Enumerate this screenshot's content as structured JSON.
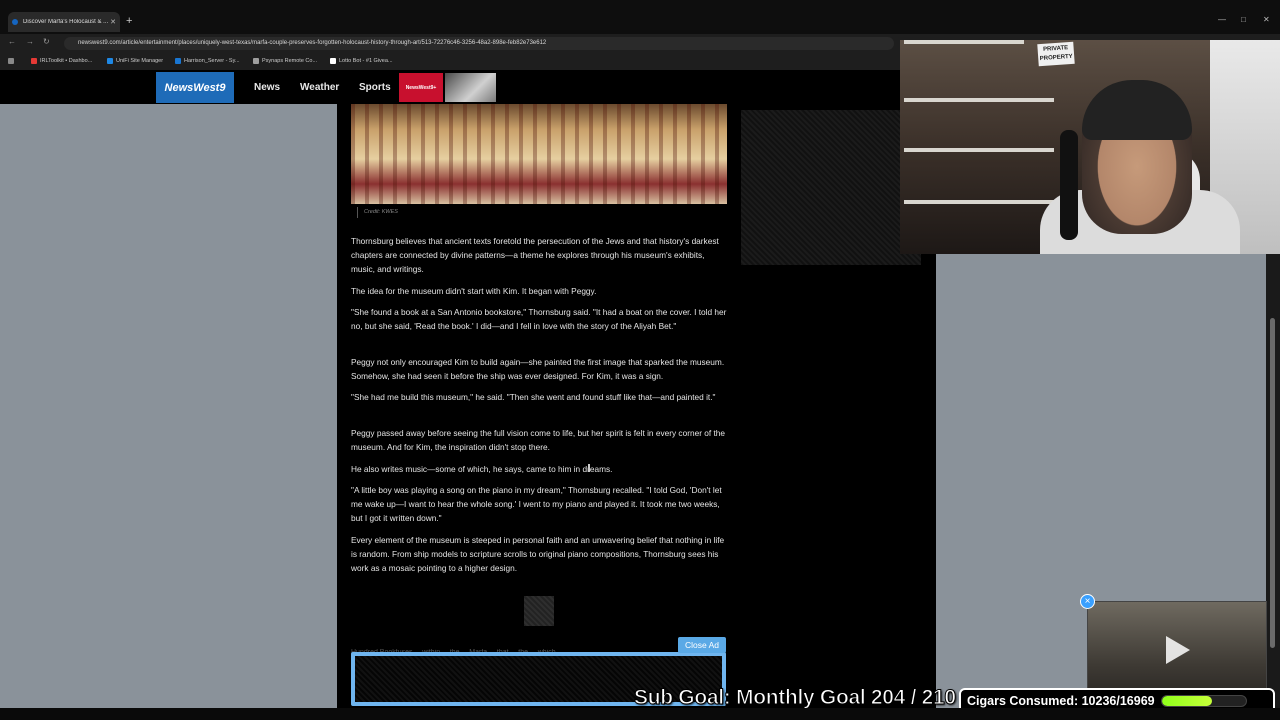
{
  "browser": {
    "tab_title": "Discover Marfa's Holocaust & ...",
    "url": "newswest9.com/article/entertainment/places/uniquely-west-texas/marfa-couple-preserves-forgotten-holocaust-history-through-art/513-72276c46-3256-48a2-898e-feb82e73e612",
    "bookmarks": [
      {
        "label": "IRLToolkit • Dashbo...",
        "color": "#e53935"
      },
      {
        "label": "UniFi Site Manager",
        "color": "#1e88e5"
      },
      {
        "label": "Harrison_Server - Sy...",
        "color": "#1976d2"
      },
      {
        "label": "Psynaps Remote Co...",
        "color": "#9e9e9e"
      },
      {
        "label": "Lotto Bot - #1 Givea...",
        "color": "#ffffff"
      }
    ]
  },
  "site": {
    "logo": "NewsWest9",
    "nav": [
      "News",
      "Weather",
      "Sports"
    ],
    "plus_label": "NewsWest9+"
  },
  "article": {
    "credit": "Credit: KWES",
    "paragraphs": [
      "Thornsburg believes that ancient texts foretold the persecution of the Jews and that history's darkest chapters are connected by divine patterns—a theme he explores through his museum's exhibits, music, and writings.",
      "The idea for the museum didn't start with Kim. It began with Peggy.",
      "\"She found a book at a San Antonio bookstore,\" Thornsburg said. \"It had a boat on the cover. I told her no, but she said, 'Read the book.' I did—and I fell in love with the story of the Aliyah Bet.\"",
      "Peggy not only encouraged Kim to build again—she painted the first image that sparked the museum. Somehow, she had seen it before the ship was ever designed. For Kim, it was a sign.",
      "\"She had me build this museum,\" he said. \"Then she went and found stuff like that—and painted it.\"",
      "Peggy passed away before seeing the full vision come to life, but her spirit is felt in every corner of the museum. And for Kim, the inspiration didn't stop there.",
      "He also writes music—some of which, he says, came to him in dreams.",
      "\"A little boy was playing a song on the piano in my dream,\" Thornsburg recalled. \"I told God, 'Don't let me wake up—I want to hear the whole song.' I went to my piano and played it. It took me two weeks, but I got it written down.\"",
      "Every element of the museum is steeped in personal faith and an unwavering belief that nothing in life is random. From ship models to scripture scrolls to original piano compositions, Thornsburg sees his work as a mosaic pointing to a higher design."
    ],
    "hidden_line": "Hundred Bookfuses ... within ... the ... Marfa ... that ... the ... which ..."
  },
  "ad": {
    "close_label": "Close Ad"
  },
  "webcam": {
    "sign_text": "PRIVATE PROPERTY"
  },
  "overlay": {
    "sub_goal": "Sub Goal: Monthly Goal  204 / 210",
    "cigars_label": "Cigars Consumed: 10236/16969",
    "cigars_progress": 0.603,
    "pip_close": "×"
  }
}
